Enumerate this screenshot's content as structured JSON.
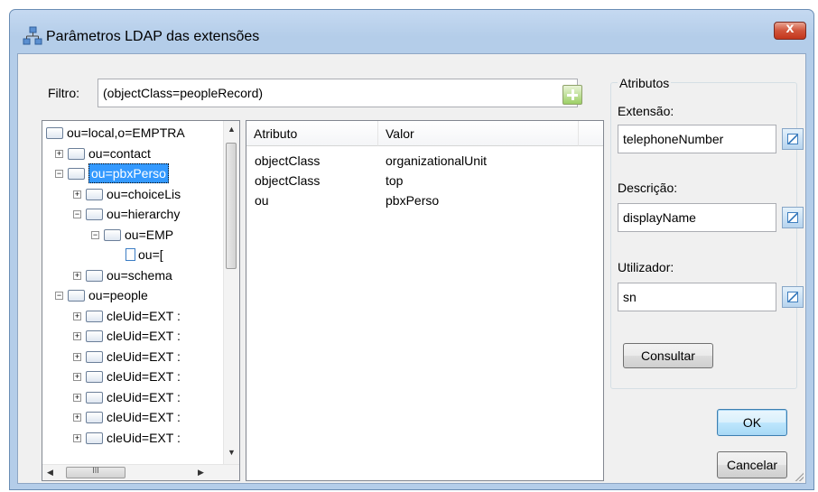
{
  "window": {
    "title": "Parâmetros LDAP das extensões",
    "close_label": "x"
  },
  "filter": {
    "label": "Filtro:",
    "value": "(objectClass=peopleRecord)"
  },
  "tree": {
    "nodes": [
      {
        "label": "ou=local,o=EMPTRA",
        "expander": ""
      },
      {
        "label": "ou=contact",
        "expander": "+"
      },
      {
        "label": "ou=pbxPerso",
        "expander": "−"
      },
      {
        "label": "ou=choiceLis",
        "expander": "+"
      },
      {
        "label": "ou=hierarchy",
        "expander": "−"
      },
      {
        "label": "ou=EMP",
        "expander": "−"
      },
      {
        "label": "ou=[",
        "expander": ""
      },
      {
        "label": "ou=schema",
        "expander": "+"
      },
      {
        "label": "ou=people",
        "expander": "−"
      },
      {
        "label": "cleUid=EXT :",
        "expander": "+"
      },
      {
        "label": "cleUid=EXT :",
        "expander": "+"
      },
      {
        "label": "cleUid=EXT :",
        "expander": "+"
      },
      {
        "label": "cleUid=EXT :",
        "expander": "+"
      },
      {
        "label": "cleUid=EXT :",
        "expander": "+"
      },
      {
        "label": "cleUid=EXT :",
        "expander": "+"
      },
      {
        "label": "cleUid=EXT :",
        "expander": "+"
      }
    ],
    "hscroll_thumb_text": "III"
  },
  "grid": {
    "headers": [
      "Atributo",
      "Valor"
    ],
    "rows": [
      [
        "objectClass",
        "organizationalUnit"
      ],
      [
        "objectClass",
        "top"
      ],
      [
        "ou",
        "pbxPerso"
      ]
    ]
  },
  "attributes": {
    "group_label": "Atributos",
    "extension_label": "Extensão:",
    "extension_value": "telephoneNumber",
    "description_label": "Descrição:",
    "description_value": "displayName",
    "user_label": "Utilizador:",
    "user_value": "sn",
    "query_button": "Consultar"
  },
  "buttons": {
    "ok": "OK",
    "cancel": "Cancelar"
  }
}
